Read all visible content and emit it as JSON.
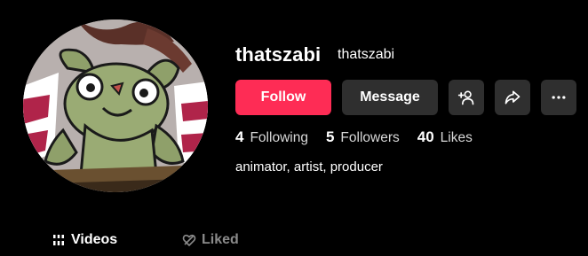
{
  "profile": {
    "username": "thatszabi",
    "nickname": "thatszabi",
    "bio": "animator, artist, producer"
  },
  "actions": {
    "follow_label": "Follow",
    "message_label": "Message",
    "icons": [
      "add-friend-icon",
      "share-icon",
      "more-icon"
    ]
  },
  "stats": [
    {
      "value": "4",
      "label": "Following"
    },
    {
      "value": "5",
      "label": "Followers"
    },
    {
      "value": "40",
      "label": "Likes"
    }
  ],
  "tabs": [
    {
      "label": "Videos",
      "icon": "grid-icon",
      "active": true
    },
    {
      "label": "Liked",
      "icon": "liked-icon",
      "active": false
    }
  ],
  "colors": {
    "background": "#000000",
    "follow_button": "#fe2c55",
    "secondary_button": "#2f2f2f",
    "inactive_tab": "#8a8a8a"
  }
}
